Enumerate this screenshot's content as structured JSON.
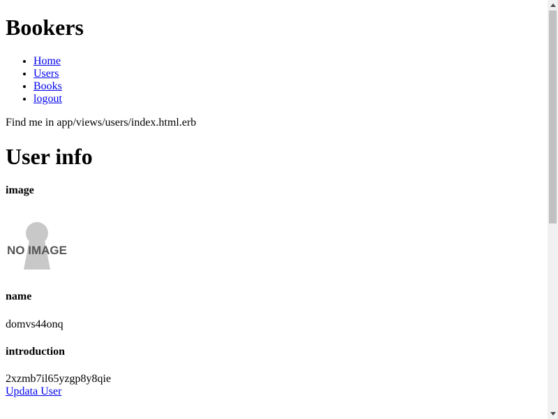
{
  "site": {
    "title": "Bookers"
  },
  "nav": {
    "items": [
      {
        "label": "Home"
      },
      {
        "label": "Users"
      },
      {
        "label": "Books"
      },
      {
        "label": "logout"
      }
    ]
  },
  "page": {
    "find_me": "Find me in app/views/users/index.html.erb",
    "section_title": "User info"
  },
  "user_info": {
    "image_heading": "image",
    "no_image_text": "NO IMAGE",
    "name_heading": "name",
    "name_value": "domvs44onq",
    "introduction_heading": "introduction",
    "introduction_value": "2xzmb7il65yzgp8y8qie",
    "update_link": "Updata User"
  },
  "colors": {
    "link": "#0000ee",
    "placeholder_gray": "#c8c8c8",
    "scrollbar_track": "#f1f1f1",
    "scrollbar_thumb": "#c1c1c1"
  },
  "icons": {
    "scroll_up": "triangle-up-icon",
    "scroll_down": "triangle-down-icon"
  }
}
